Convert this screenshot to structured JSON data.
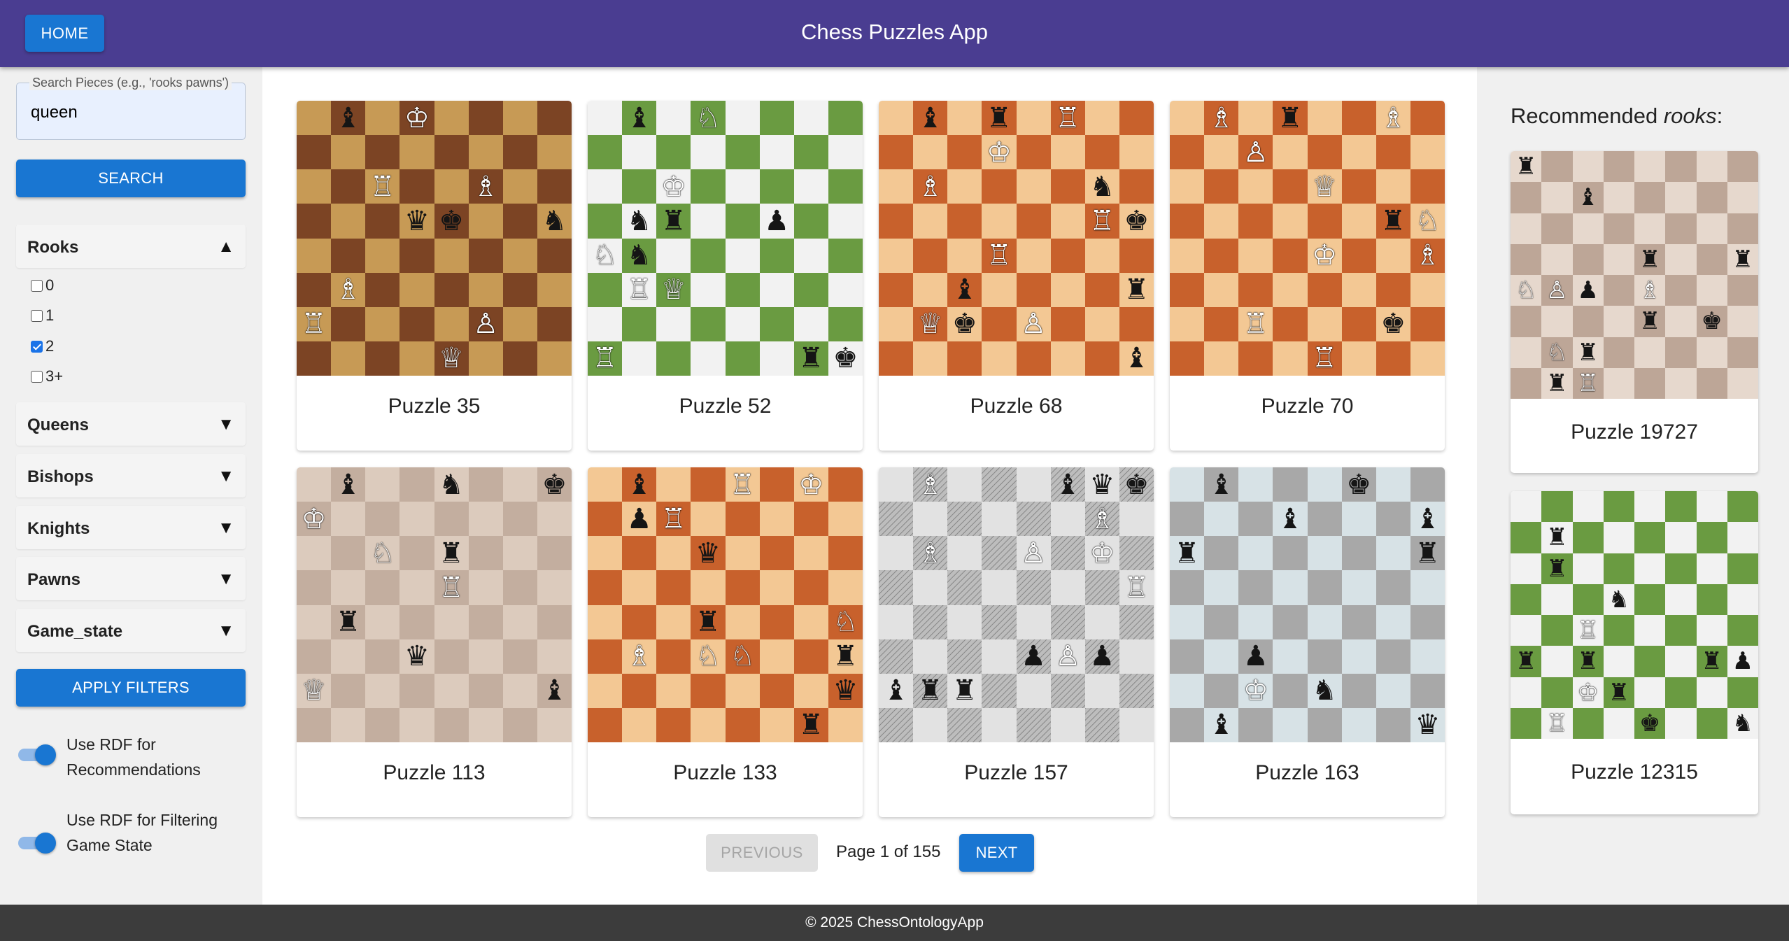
{
  "header": {
    "home_label": "HOME",
    "title": "Chess Puzzles App"
  },
  "sidebar": {
    "search_label": "Search Pieces (e.g., 'rooks pawns')",
    "search_value": "queen",
    "search_button": "SEARCH",
    "filters": [
      {
        "label": "Rooks",
        "expanded": true,
        "options": [
          {
            "label": "0",
            "checked": false
          },
          {
            "label": "1",
            "checked": false
          },
          {
            "label": "2",
            "checked": true
          },
          {
            "label": "3+",
            "checked": false
          }
        ]
      },
      {
        "label": "Queens",
        "expanded": false
      },
      {
        "label": "Bishops",
        "expanded": false
      },
      {
        "label": "Knights",
        "expanded": false
      },
      {
        "label": "Pawns",
        "expanded": false
      },
      {
        "label": "Game_state",
        "expanded": false
      }
    ],
    "apply_button": "APPLY FILTERS",
    "toggles": [
      {
        "label_line1": "Use RDF for",
        "label_line2": "Recommendations",
        "on": true
      },
      {
        "label_line1": "Use RDF for Filtering",
        "label_line2": "Game State",
        "on": true
      }
    ]
  },
  "main": {
    "puzzles": [
      {
        "label": "Puzzle 35",
        "theme": "walnut",
        "pieces": [
          [
            0,
            1,
            "b",
            "b"
          ],
          [
            0,
            3,
            "w",
            "k"
          ],
          [
            2,
            2,
            "w",
            "r"
          ],
          [
            2,
            5,
            "w",
            "b"
          ],
          [
            3,
            3,
            "b",
            "q"
          ],
          [
            3,
            4,
            "b",
            "k"
          ],
          [
            3,
            7,
            "b",
            "n"
          ],
          [
            5,
            1,
            "w",
            "b"
          ],
          [
            6,
            0,
            "w",
            "r"
          ],
          [
            6,
            5,
            "w",
            "p"
          ],
          [
            7,
            4,
            "w",
            "q"
          ]
        ]
      },
      {
        "label": "Puzzle 52",
        "theme": "green",
        "pieces": [
          [
            0,
            1,
            "b",
            "b"
          ],
          [
            0,
            3,
            "w",
            "n"
          ],
          [
            2,
            2,
            "w",
            "k"
          ],
          [
            3,
            1,
            "b",
            "n"
          ],
          [
            3,
            2,
            "b",
            "r"
          ],
          [
            3,
            5,
            "b",
            "p"
          ],
          [
            4,
            0,
            "w",
            "n"
          ],
          [
            4,
            1,
            "b",
            "n"
          ],
          [
            5,
            1,
            "w",
            "r"
          ],
          [
            5,
            2,
            "w",
            "q"
          ],
          [
            7,
            0,
            "w",
            "r"
          ],
          [
            7,
            6,
            "b",
            "r"
          ],
          [
            7,
            7,
            "b",
            "k"
          ]
        ]
      },
      {
        "label": "Puzzle 68",
        "theme": "orange",
        "pieces": [
          [
            0,
            1,
            "b",
            "b"
          ],
          [
            0,
            3,
            "b",
            "r"
          ],
          [
            0,
            5,
            "w",
            "r"
          ],
          [
            1,
            3,
            "w",
            "k"
          ],
          [
            2,
            1,
            "w",
            "b"
          ],
          [
            2,
            6,
            "b",
            "n"
          ],
          [
            3,
            6,
            "w",
            "r"
          ],
          [
            3,
            7,
            "b",
            "k"
          ],
          [
            4,
            3,
            "w",
            "r"
          ],
          [
            5,
            2,
            "b",
            "b"
          ],
          [
            5,
            7,
            "b",
            "r"
          ],
          [
            6,
            1,
            "w",
            "q"
          ],
          [
            6,
            2,
            "b",
            "k"
          ],
          [
            6,
            4,
            "w",
            "p"
          ],
          [
            7,
            7,
            "b",
            "b"
          ]
        ]
      },
      {
        "label": "Puzzle 70",
        "theme": "orange",
        "pieces": [
          [
            0,
            1,
            "w",
            "b"
          ],
          [
            0,
            3,
            "b",
            "r"
          ],
          [
            0,
            6,
            "w",
            "b"
          ],
          [
            1,
            2,
            "w",
            "p"
          ],
          [
            2,
            4,
            "w",
            "q"
          ],
          [
            3,
            6,
            "b",
            "r"
          ],
          [
            3,
            7,
            "w",
            "n"
          ],
          [
            4,
            4,
            "w",
            "k"
          ],
          [
            4,
            7,
            "w",
            "b"
          ],
          [
            6,
            2,
            "w",
            "r"
          ],
          [
            6,
            6,
            "b",
            "k"
          ],
          [
            7,
            4,
            "w",
            "r"
          ]
        ]
      },
      {
        "label": "Puzzle 113",
        "theme": "marble",
        "pieces": [
          [
            0,
            1,
            "b",
            "b"
          ],
          [
            0,
            4,
            "b",
            "n"
          ],
          [
            0,
            7,
            "b",
            "k"
          ],
          [
            1,
            0,
            "w",
            "k"
          ],
          [
            2,
            2,
            "w",
            "n"
          ],
          [
            2,
            4,
            "b",
            "r"
          ],
          [
            3,
            4,
            "w",
            "r"
          ],
          [
            4,
            1,
            "b",
            "r"
          ],
          [
            5,
            3,
            "b",
            "q"
          ],
          [
            6,
            0,
            "w",
            "q"
          ],
          [
            6,
            7,
            "b",
            "b"
          ]
        ]
      },
      {
        "label": "Puzzle 133",
        "theme": "orange",
        "pieces": [
          [
            0,
            1,
            "b",
            "b"
          ],
          [
            0,
            4,
            "w",
            "r"
          ],
          [
            0,
            6,
            "w",
            "k"
          ],
          [
            1,
            1,
            "b",
            "p"
          ],
          [
            1,
            2,
            "w",
            "r"
          ],
          [
            2,
            3,
            "b",
            "q"
          ],
          [
            4,
            3,
            "b",
            "r"
          ],
          [
            4,
            7,
            "w",
            "n"
          ],
          [
            5,
            1,
            "w",
            "b"
          ],
          [
            5,
            3,
            "w",
            "n"
          ],
          [
            5,
            4,
            "w",
            "n"
          ],
          [
            5,
            7,
            "b",
            "r"
          ],
          [
            6,
            7,
            "b",
            "q"
          ],
          [
            7,
            6,
            "b",
            "r"
          ]
        ]
      },
      {
        "label": "Puzzle 157",
        "theme": "sketch",
        "pieces": [
          [
            0,
            1,
            "w",
            "b"
          ],
          [
            0,
            5,
            "b",
            "b"
          ],
          [
            0,
            6,
            "b",
            "q"
          ],
          [
            0,
            7,
            "b",
            "k"
          ],
          [
            1,
            6,
            "w",
            "b"
          ],
          [
            2,
            1,
            "w",
            "b"
          ],
          [
            2,
            4,
            "w",
            "p"
          ],
          [
            2,
            6,
            "w",
            "k"
          ],
          [
            3,
            7,
            "w",
            "r"
          ],
          [
            5,
            4,
            "b",
            "p"
          ],
          [
            5,
            5,
            "w",
            "p"
          ],
          [
            5,
            6,
            "b",
            "p"
          ],
          [
            6,
            0,
            "b",
            "b"
          ],
          [
            6,
            1,
            "b",
            "r"
          ],
          [
            6,
            2,
            "b",
            "r"
          ]
        ]
      },
      {
        "label": "Puzzle 163",
        "theme": "granite",
        "pieces": [
          [
            0,
            1,
            "b",
            "b"
          ],
          [
            0,
            5,
            "b",
            "k"
          ],
          [
            1,
            3,
            "b",
            "b"
          ],
          [
            1,
            7,
            "b",
            "b"
          ],
          [
            2,
            0,
            "b",
            "r"
          ],
          [
            2,
            7,
            "b",
            "r"
          ],
          [
            5,
            2,
            "b",
            "p"
          ],
          [
            6,
            2,
            "w",
            "k"
          ],
          [
            6,
            4,
            "b",
            "n"
          ],
          [
            7,
            1,
            "b",
            "b"
          ],
          [
            7,
            7,
            "b",
            "q"
          ]
        ]
      }
    ],
    "prev_label": "PREVIOUS",
    "page_info": "Page 1 of 155",
    "next_label": "NEXT"
  },
  "recommended": {
    "title_prefix": "Recommended ",
    "title_emph": "rooks",
    "title_suffix": ":",
    "puzzles": [
      {
        "label": "Puzzle 19727",
        "theme": "marble2",
        "pieces": [
          [
            0,
            0,
            "b",
            "r"
          ],
          [
            1,
            2,
            "b",
            "b"
          ],
          [
            3,
            4,
            "b",
            "r"
          ],
          [
            3,
            7,
            "b",
            "r"
          ],
          [
            4,
            0,
            "w",
            "n"
          ],
          [
            4,
            1,
            "w",
            "p"
          ],
          [
            4,
            2,
            "b",
            "p"
          ],
          [
            4,
            4,
            "w",
            "b"
          ],
          [
            5,
            4,
            "b",
            "r"
          ],
          [
            5,
            6,
            "b",
            "k"
          ],
          [
            6,
            1,
            "w",
            "n"
          ],
          [
            6,
            2,
            "b",
            "r"
          ],
          [
            7,
            1,
            "b",
            "r"
          ],
          [
            7,
            2,
            "w",
            "r"
          ]
        ]
      },
      {
        "label": "Puzzle 12315",
        "theme": "green",
        "pieces": [
          [
            1,
            1,
            "b",
            "r"
          ],
          [
            2,
            1,
            "b",
            "r"
          ],
          [
            3,
            3,
            "b",
            "n"
          ],
          [
            4,
            2,
            "w",
            "r"
          ],
          [
            5,
            0,
            "b",
            "r"
          ],
          [
            5,
            2,
            "b",
            "r"
          ],
          [
            5,
            6,
            "b",
            "r"
          ],
          [
            5,
            7,
            "b",
            "p"
          ],
          [
            6,
            2,
            "w",
            "k"
          ],
          [
            6,
            3,
            "b",
            "r"
          ],
          [
            7,
            1,
            "w",
            "r"
          ],
          [
            7,
            4,
            "b",
            "k"
          ],
          [
            7,
            7,
            "b",
            "n"
          ]
        ]
      }
    ]
  },
  "footer": {
    "text": "© 2025 ChessOntologyApp"
  },
  "themes": {
    "walnut": {
      "light": "#c79a55",
      "dark": "#7c4424"
    },
    "green": {
      "light": "#f2f2f2",
      "dark": "#6a9b41"
    },
    "orange": {
      "light": "#f3c894",
      "dark": "#c8612c"
    },
    "marble": {
      "light": "#dccbbd",
      "dark": "#c3ae9f"
    },
    "marble2": {
      "light": "#e6d8cd",
      "dark": "#bda697"
    },
    "sketch": {
      "light": "#e2e2e2",
      "dark": "#bdbdbd"
    },
    "granite": {
      "light": "#d7e2e6",
      "dark": "#a8a8a8"
    }
  }
}
